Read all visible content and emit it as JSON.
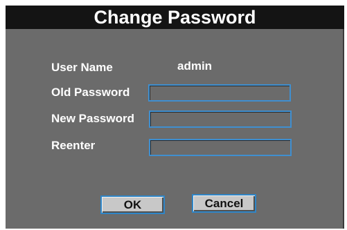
{
  "dialog": {
    "title": "Change Password",
    "username_label": "User Name",
    "username_value": "admin",
    "old_password_label": "Old Password",
    "new_password_label": "New Password",
    "reenter_label": "Reenter",
    "old_password_value": "",
    "new_password_value": "",
    "reenter_value": "",
    "ok_label": "OK",
    "cancel_label": "Cancel"
  },
  "colors": {
    "title_bg": "#141414",
    "dialog_bg": "#6b6b6b",
    "field_border": "#3f8fd0",
    "button_bg": "#c8c8c8"
  }
}
